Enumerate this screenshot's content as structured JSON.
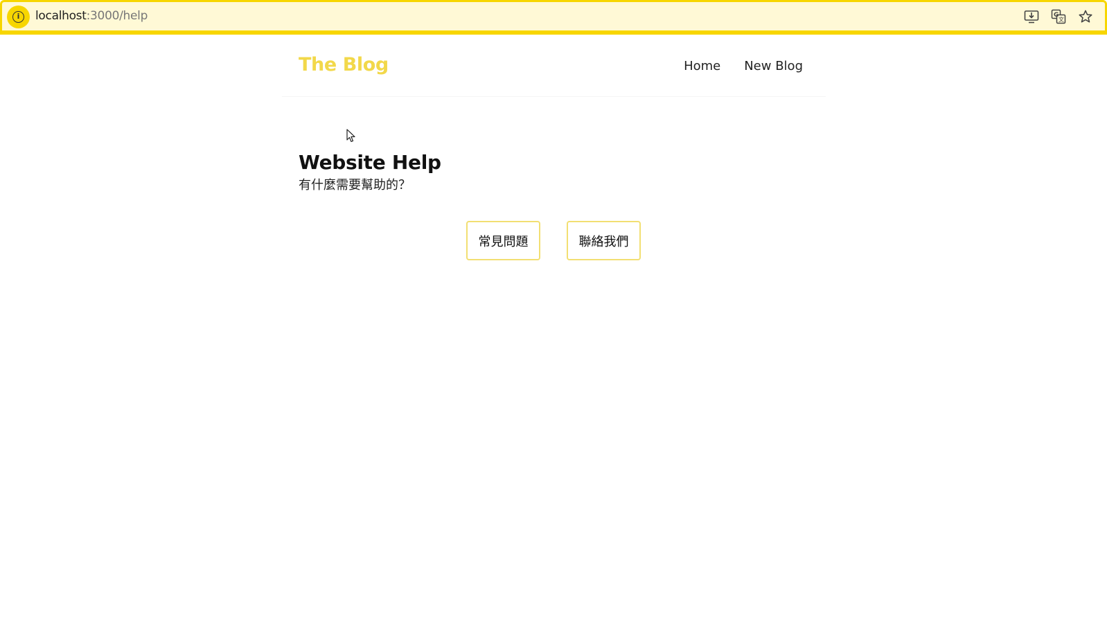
{
  "browser": {
    "url_host": "localhost",
    "url_path": ":3000/help",
    "info_icon": "info-icon",
    "toolbar_icons": [
      "install-app-icon",
      "translate-icon",
      "bookmark-star-icon"
    ],
    "accent_color": "#f7d600"
  },
  "navbar": {
    "brand": "The Blog",
    "brand_color": "#f2d84a",
    "links": [
      {
        "label": "Home"
      },
      {
        "label": "New Blog"
      }
    ]
  },
  "main": {
    "title": "Website Help",
    "subtitle": "有什麼需要幫助的？",
    "buttons": [
      {
        "label": "常見問題"
      },
      {
        "label": "聯絡我們"
      }
    ],
    "button_border_color": "#f2df72"
  }
}
